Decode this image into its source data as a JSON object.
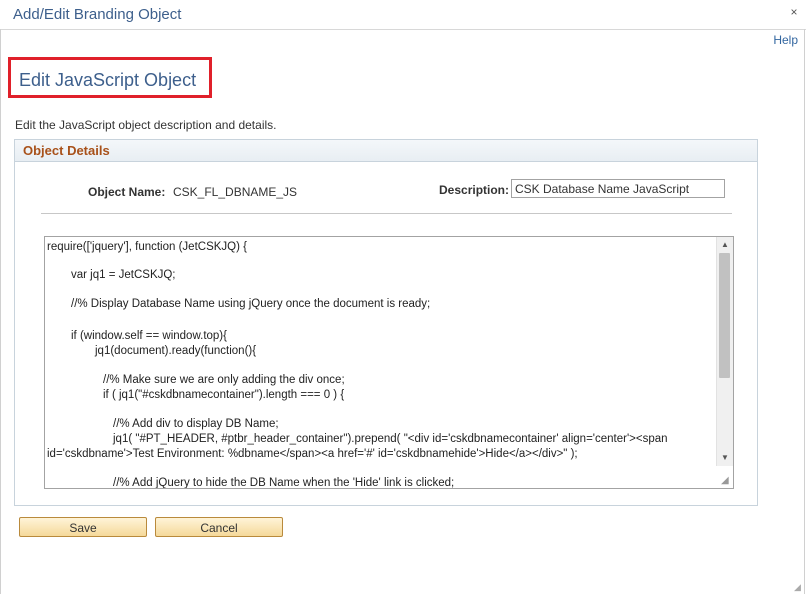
{
  "window": {
    "title": "Add/Edit Branding Object",
    "close_symbol": "×"
  },
  "help_link": "Help",
  "page_title": "Edit JavaScript Object",
  "instructions": "Edit the JavaScript object description and details.",
  "group": {
    "header": "Object Details",
    "object_name_label": "Object Name:",
    "object_name_value": "CSK_FL_DBNAME_JS",
    "description_label": "Description:",
    "description_value": "CSK Database Name JavaScript"
  },
  "code_lines": [
    "require(['jquery'], function (JetCSKJQ) {",
    "var jq1 = JetCSKJQ;",
    "//% Display Database Name using jQuery once the document is ready;",
    "if (window.self == window.top){",
    "jq1(document).ready(function(){",
    "//% Make sure we are only adding the div once;",
    "if ( jq1(\"#cskdbnamecontainer\").length === 0 ) {",
    "//% Add div to display DB Name;",
    "jq1( \"#PT_HEADER, #ptbr_header_container\").prepend( \"<div id='cskdbnamecontainer' align='center'><span",
    "id='cskdbname'>Test Environment: %dbname</span><a href='#' id='cskdbnamehide'>Hide</a></div>\" );",
    "//% Add jQuery to hide the DB Name when the 'Hide' link is clicked;"
  ],
  "buttons": {
    "save": "Save",
    "cancel": "Cancel"
  },
  "colors": {
    "title_blue": "#3d5f8c",
    "highlight_red": "#e0202a",
    "group_header_orange": "#a8511a"
  }
}
